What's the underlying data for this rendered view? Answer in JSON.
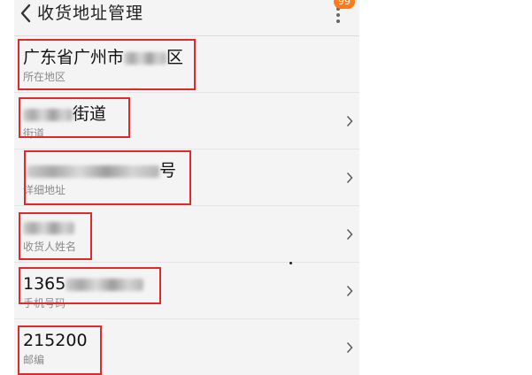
{
  "header": {
    "title": "收货地址管理",
    "badge_count": "99"
  },
  "fields": [
    {
      "value_prefix": "广东省广州市",
      "value_suffix": "区",
      "label": "所在地区",
      "has_chevron": false
    },
    {
      "value_prefix": "",
      "value_suffix": "街道",
      "label": "街道",
      "has_chevron": true
    },
    {
      "value_prefix": "",
      "value_suffix": "号",
      "label": "详细地址",
      "has_chevron": true
    },
    {
      "value_prefix": "",
      "value_suffix": "",
      "label": "收货人姓名",
      "has_chevron": true
    },
    {
      "value_prefix": "1365",
      "value_suffix": "",
      "label": "手机号码",
      "has_chevron": true
    },
    {
      "value_prefix": "215200",
      "value_suffix": "",
      "label": "邮编",
      "has_chevron": true
    }
  ],
  "colors": {
    "highlight": "#e02a2a",
    "badge": "#ff7a1a"
  }
}
